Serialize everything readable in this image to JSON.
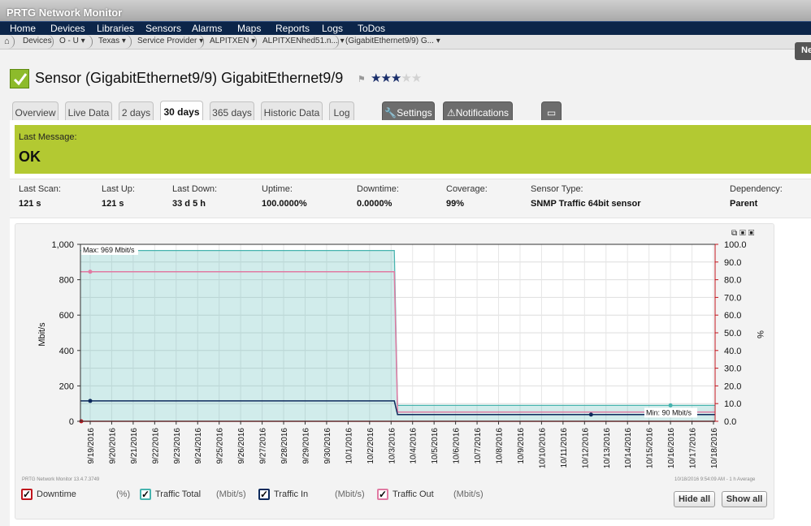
{
  "app_title": "PRTG Network Monitor",
  "menu": [
    "Home",
    "Devices",
    "Libraries",
    "Sensors",
    "Alarms",
    "Maps",
    "Reports",
    "Logs",
    "ToDos"
  ],
  "breadcrumb": [
    "Devices",
    "O - U",
    "Texas",
    "Service Provider",
    "ALPITXEN",
    "ALPITXENhed51.n...",
    "(GigabitEthernet9/9) G..."
  ],
  "new_label": "Ne",
  "sensor": {
    "title": "Sensor (GigabitEthernet9/9) GigabitEthernet9/9",
    "priority_stars": 3,
    "priority_max": 5,
    "status_color": "#8dbb2b"
  },
  "tabs": [
    "Overview",
    "Live Data",
    "2 days",
    "30 days",
    "365 days",
    "Historic Data",
    "Log"
  ],
  "active_tab": "30 days",
  "action_tabs": {
    "settings": "Settings",
    "notifications": "Notifications"
  },
  "last_message": {
    "label": "Last Message:",
    "value": "OK"
  },
  "stats": [
    {
      "label": "Last Scan:",
      "value": "121 s"
    },
    {
      "label": "Last Up:",
      "value": "121 s"
    },
    {
      "label": "Last Down:",
      "value": "33 d 5 h"
    },
    {
      "label": "Uptime:",
      "value": "100.0000%"
    },
    {
      "label": "Downtime:",
      "value": "0.0000%"
    },
    {
      "label": "Coverage:",
      "value": "99%"
    },
    {
      "label": "Sensor Type:",
      "value": "SNMP Traffic 64bit sensor"
    },
    {
      "label": "Dependency:",
      "value": "Parent"
    }
  ],
  "chart_data": {
    "type": "area",
    "ylabel": "Mbit/s",
    "y2label": "%",
    "ylim": [
      0,
      1000
    ],
    "y2lim": [
      0,
      100
    ],
    "yticks": [
      "0",
      "200",
      "400",
      "600",
      "800",
      "1,000"
    ],
    "y2ticks": [
      "0.0",
      "10.0",
      "20.0",
      "30.0",
      "40.0",
      "50.0",
      "60.0",
      "70.0",
      "80.0",
      "90.0",
      "100.0"
    ],
    "categories": [
      "9/19/2016",
      "9/20/2016",
      "9/21/2016",
      "9/22/2016",
      "9/23/2016",
      "9/24/2016",
      "9/25/2016",
      "9/26/2016",
      "9/27/2016",
      "9/28/2016",
      "9/29/2016",
      "9/30/2016",
      "10/1/2016",
      "10/2/2016",
      "10/3/2016",
      "10/4/2016",
      "10/5/2016",
      "10/6/2016",
      "10/7/2016",
      "10/8/2016",
      "10/9/2016",
      "10/10/2016",
      "10/11/2016",
      "10/12/2016",
      "10/13/2016",
      "10/14/2016",
      "10/15/2016",
      "10/16/2016",
      "10/17/2016",
      "10/18/2016"
    ],
    "max_label": "Max: 969 Mbit/s",
    "min_label": "Min: 90 Mbit/s",
    "series": [
      {
        "name": "Downtime",
        "unit": "(%)",
        "color": "#c0141c",
        "values": [
          0,
          0,
          0,
          0,
          0,
          0,
          0,
          0,
          0,
          0,
          0,
          0,
          0,
          0,
          0,
          0,
          0,
          0,
          0,
          0,
          0,
          0,
          0,
          0,
          0,
          0,
          0,
          0,
          0,
          0
        ]
      },
      {
        "name": "Traffic Total",
        "unit": "(Mbit/s)",
        "color": "#46b3ae",
        "values": [
          965,
          965,
          965,
          965,
          965,
          965,
          965,
          965,
          965,
          965,
          965,
          965,
          965,
          965,
          965,
          90,
          90,
          90,
          90,
          90,
          90,
          90,
          90,
          90,
          90,
          90,
          90,
          90,
          90,
          90
        ]
      },
      {
        "name": "Traffic In",
        "unit": "(Mbit/s)",
        "color": "#0d2a5c",
        "values": [
          115,
          115,
          115,
          115,
          115,
          115,
          115,
          115,
          115,
          115,
          115,
          115,
          115,
          115,
          115,
          38,
          38,
          38,
          38,
          38,
          38,
          38,
          38,
          38,
          38,
          38,
          38,
          38,
          38,
          38
        ]
      },
      {
        "name": "Traffic Out",
        "unit": "(Mbit/s)",
        "color": "#e07aa2",
        "values": [
          845,
          845,
          845,
          845,
          845,
          845,
          845,
          845,
          845,
          845,
          845,
          845,
          845,
          845,
          845,
          52,
          52,
          52,
          52,
          52,
          52,
          52,
          52,
          52,
          52,
          52,
          52,
          52,
          52,
          52
        ]
      }
    ],
    "legend_placement": "bottom"
  },
  "footer_left": "PRTG Network Monitor 13.4.7.3749",
  "footer_right": "10/18/2016 9:54:09 AM - 1 h Average",
  "buttons": {
    "hide_all": "Hide all",
    "show_all": "Show all"
  }
}
